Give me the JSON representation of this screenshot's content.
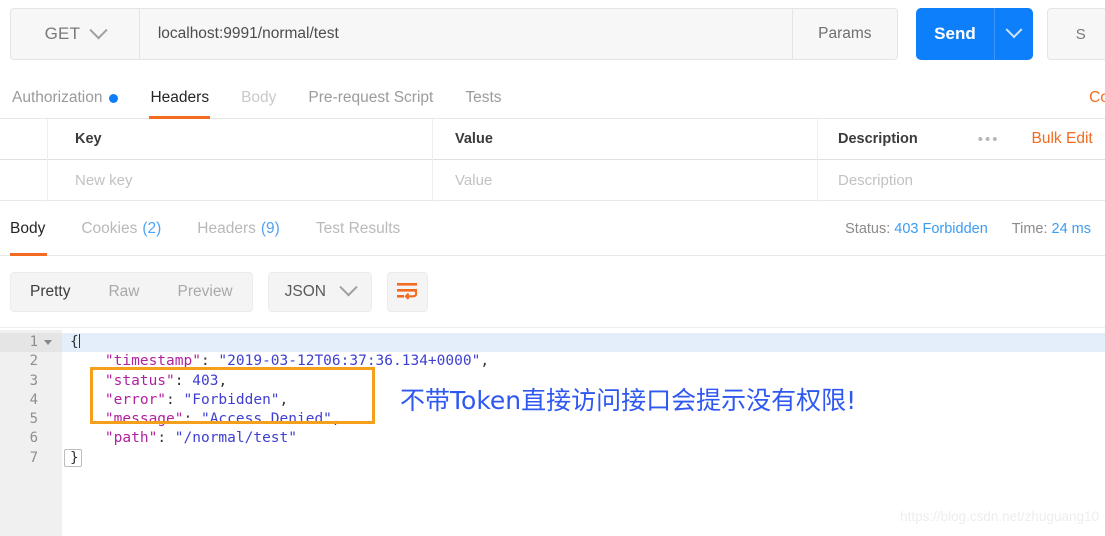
{
  "request": {
    "method": "GET",
    "method_chevron_icon": "chevron-down-icon",
    "url": "localhost:9991/normal/test",
    "params_label": "Params",
    "send_label": "Send",
    "send_chevron_icon": "chevron-down-icon",
    "save_label": "S"
  },
  "request_tabs": [
    {
      "label": "Authorization",
      "state": "muted",
      "has_dot": true
    },
    {
      "label": "Headers",
      "state": "active",
      "has_dot": false
    },
    {
      "label": "Body",
      "state": "dim",
      "has_dot": false
    },
    {
      "label": "Pre-request Script",
      "state": "muted",
      "has_dot": false
    },
    {
      "label": "Tests",
      "state": "muted",
      "has_dot": false
    }
  ],
  "code_link_label": "Co",
  "headers_table": {
    "columns": [
      "Key",
      "Value",
      "Description"
    ],
    "more_icon": "ellipsis-icon",
    "bulk_edit_label": "Bulk Edit",
    "new_row_placeholders": [
      "New key",
      "Value",
      "Description"
    ]
  },
  "response_tabs": [
    {
      "label": "Body",
      "count": "",
      "state": "active"
    },
    {
      "label": "Cookies",
      "count": "(2)",
      "state": "dim"
    },
    {
      "label": "Headers",
      "count": "(9)",
      "state": "dim"
    },
    {
      "label": "Test Results",
      "count": "",
      "state": "dim"
    }
  ],
  "response_meta": {
    "status_label": "Status:",
    "status_value": "403 Forbidden",
    "time_label": "Time:",
    "time_value": "24 ms"
  },
  "body_toolbar": {
    "views": [
      "Pretty",
      "Raw",
      "Preview"
    ],
    "active_view": "Pretty",
    "format": "JSON",
    "format_chevron_icon": "chevron-down-icon",
    "wrap_icon": "word-wrap-icon"
  },
  "code": {
    "line_numbers": [
      "1",
      "2",
      "3",
      "4",
      "5",
      "6",
      "7"
    ],
    "lines": [
      {
        "n": "1",
        "indent": 0,
        "tokens": [
          {
            "t": "p",
            "v": "{"
          }
        ],
        "highlight": true,
        "fold": true
      },
      {
        "n": "2",
        "indent": 1,
        "tokens": [
          {
            "t": "k",
            "v": "\"timestamp\""
          },
          {
            "t": "p",
            "v": ": "
          },
          {
            "t": "s",
            "v": "\"2019-03-12T06:37:36.134+0000\""
          },
          {
            "t": "p",
            "v": ","
          }
        ]
      },
      {
        "n": "3",
        "indent": 1,
        "tokens": [
          {
            "t": "k",
            "v": "\"status\""
          },
          {
            "t": "p",
            "v": ": "
          },
          {
            "t": "n",
            "v": "403"
          },
          {
            "t": "p",
            "v": ","
          }
        ]
      },
      {
        "n": "4",
        "indent": 1,
        "tokens": [
          {
            "t": "k",
            "v": "\"error\""
          },
          {
            "t": "p",
            "v": ": "
          },
          {
            "t": "s",
            "v": "\"Forbidden\""
          },
          {
            "t": "p",
            "v": ","
          }
        ]
      },
      {
        "n": "5",
        "indent": 1,
        "tokens": [
          {
            "t": "k",
            "v": "\"message\""
          },
          {
            "t": "p",
            "v": ": "
          },
          {
            "t": "s",
            "v": "\"Access Denied\""
          },
          {
            "t": "p",
            "v": ","
          }
        ]
      },
      {
        "n": "6",
        "indent": 1,
        "tokens": [
          {
            "t": "k",
            "v": "\"path\""
          },
          {
            "t": "p",
            "v": ": "
          },
          {
            "t": "s",
            "v": "\"/normal/test\""
          }
        ]
      },
      {
        "n": "7",
        "indent": 0,
        "tokens": [
          {
            "t": "p",
            "v": "}"
          }
        ]
      }
    ]
  },
  "annotation": {
    "text": "不带Token直接访问接口会提示没有权限!",
    "box_color": "#f5a01c",
    "text_color": "#2f58f0"
  },
  "watermark": "https://blog.csdn.net/zhuguang10",
  "colors": {
    "accent_orange": "#f26b21",
    "accent_blue": "#0d7ffb",
    "status_blue": "#3d9bf3",
    "json_key": "#b0229f",
    "json_string": "#3f3fd1"
  }
}
